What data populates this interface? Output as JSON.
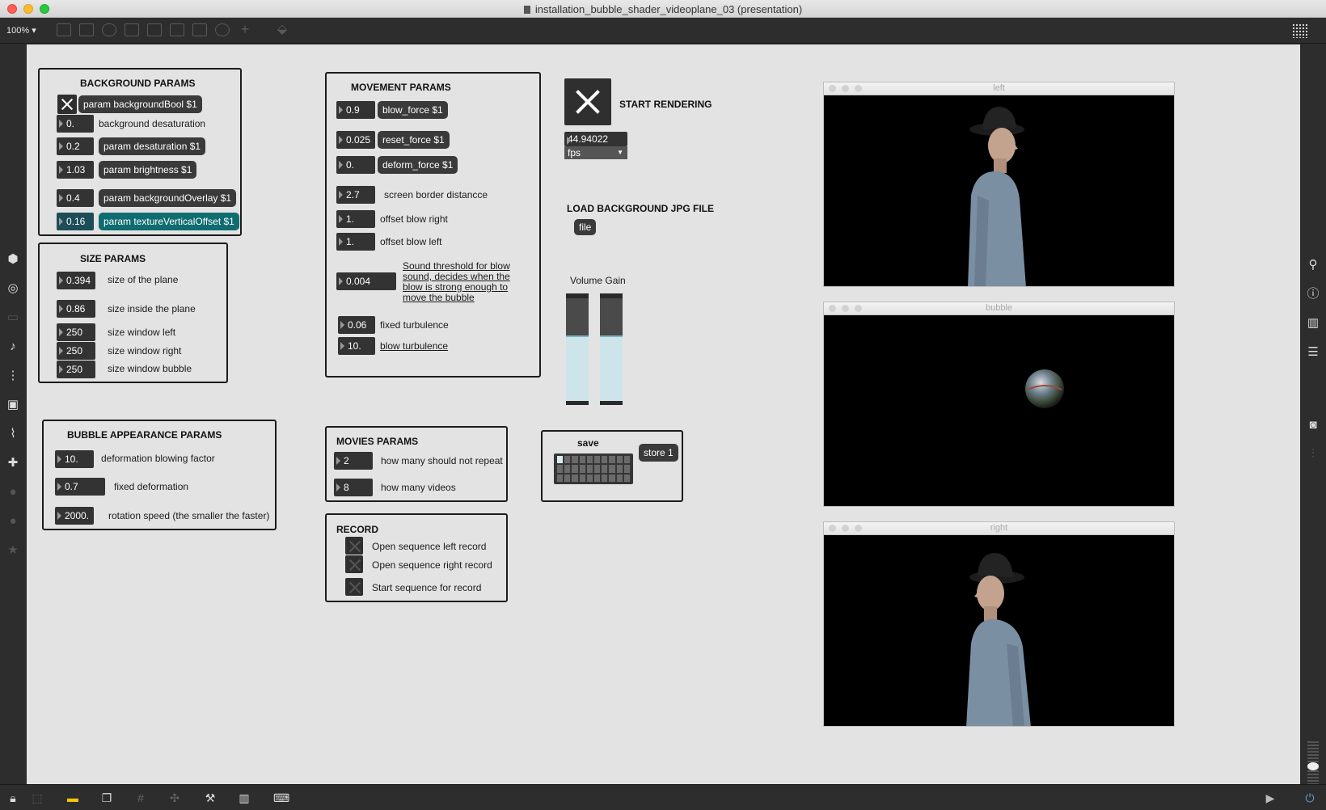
{
  "window": {
    "title": "installation_bubble_shader_videoplane_03 (presentation)"
  },
  "toolbar": {
    "zoom": "100%"
  },
  "background_params": {
    "title": "BACKGROUND PARAMS",
    "toggle_message": "param backgroundBool $1",
    "rows": [
      {
        "value": "0.",
        "label": "background desaturation"
      },
      {
        "value": "0.2",
        "label": "param desaturation $1"
      },
      {
        "value": "1.03",
        "label": "param brightness $1"
      },
      {
        "value": "0.4",
        "label": "param backgroundOverlay $1"
      },
      {
        "value": "0.16",
        "label": "param textureVerticalOffset $1"
      }
    ]
  },
  "size_params": {
    "title": "SIZE PARAMS",
    "rows": [
      {
        "value": "0.394",
        "label": "size of the plane"
      },
      {
        "value": "0.86",
        "label": "size inside the plane"
      },
      {
        "value": "250",
        "label": "size window left"
      },
      {
        "value": "250",
        "label": "size window right"
      },
      {
        "value": "250",
        "label": "size window bubble"
      }
    ]
  },
  "bubble_params": {
    "title": "BUBBLE APPEARANCE PARAMS",
    "rows": [
      {
        "value": "10.",
        "label": "deformation blowing factor"
      },
      {
        "value": "0.7",
        "label": "fixed deformation"
      },
      {
        "value": "2000.",
        "label": "rotation speed (the smaller the faster)"
      }
    ]
  },
  "movement_params": {
    "title": "MOVEMENT PARAMS",
    "rows": [
      {
        "value": "0.9",
        "label": "blow_force $1"
      },
      {
        "value": "0.025",
        "label": "reset_force $1"
      },
      {
        "value": "0.",
        "label": "deform_force $1"
      },
      {
        "value": "2.7",
        "label": "screen border distancce"
      },
      {
        "value": "1.",
        "label": "offset blow right"
      },
      {
        "value": "1.",
        "label": "offset blow left"
      },
      {
        "value": "0.004",
        "label_lines": [
          "Sound threshold for blow",
          "sound, decides when the",
          "blow is strong enough to",
          "move the bubble"
        ]
      },
      {
        "value": "0.06",
        "label": "fixed turbulence"
      },
      {
        "value": "10.",
        "label": "blow turbulence"
      }
    ]
  },
  "rendering": {
    "label": "START RENDERING",
    "fps_value": "44.94022",
    "fps_unit": "fps",
    "load_label": "LOAD BACKGROUND JPG FILE",
    "file_button": "file",
    "volume_label": "Volume Gain",
    "volume_levels": [
      0.62,
      0.62
    ]
  },
  "movies_params": {
    "title": "MOVIES PARAMS",
    "rows": [
      {
        "value": "2",
        "label": "how many should not repeat"
      },
      {
        "value": "8",
        "label": "how many videos"
      }
    ]
  },
  "record": {
    "title": "RECORD",
    "items": [
      "Open sequence left record",
      "Open sequence right record",
      "Start sequence for record"
    ]
  },
  "preset": {
    "label": "save",
    "store_button": "store 1"
  },
  "video_windows": {
    "left": "left",
    "bubble": "bubble",
    "right": "right"
  },
  "colors": {
    "canvas": "#e3e3e3",
    "teal": "#0f6c70",
    "dark_box": "#333333"
  }
}
